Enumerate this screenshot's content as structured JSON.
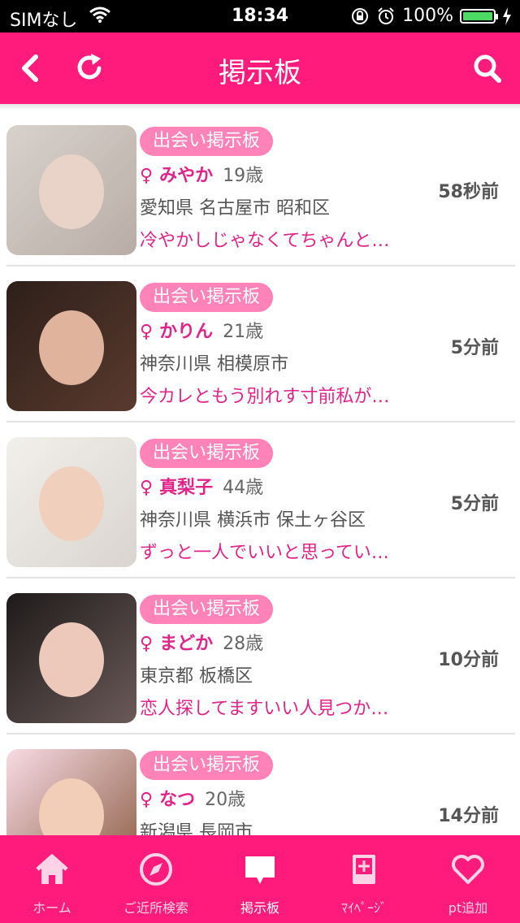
{
  "status_bar": {
    "carrier": "SIMなし",
    "time": "18:34",
    "battery": "100%"
  },
  "header": {
    "title": "掲示板"
  },
  "posts": [
    {
      "badge": "出会い掲示板",
      "sex": "♀",
      "name": "みやか",
      "age": "19歳",
      "location": "愛知県 名古屋市 昭和区",
      "message": "冷やかしじゃなくてちゃんと…",
      "time_ago": "58秒前"
    },
    {
      "badge": "出会い掲示板",
      "sex": "♀",
      "name": "かりん",
      "age": "21歳",
      "location": "神奈川県 相模原市",
      "message": "今カレともう別れす寸前私が…",
      "time_ago": "5分前"
    },
    {
      "badge": "出会い掲示板",
      "sex": "♀",
      "name": "真梨子",
      "age": "44歳",
      "location": "神奈川県 横浜市 保土ヶ谷区",
      "message": "ずっと一人でいいと思ってい…",
      "time_ago": "5分前"
    },
    {
      "badge": "出会い掲示板",
      "sex": "♀",
      "name": "まどか",
      "age": "28歳",
      "location": "東京都 板橋区",
      "message": "恋人探してますいい人見つか…",
      "time_ago": "10分前"
    },
    {
      "badge": "出会い掲示板",
      "sex": "♀",
      "name": "なつ",
      "age": "20歳",
      "location": "新潟県 長岡市",
      "message": "",
      "time_ago": "14分前"
    }
  ],
  "tabs": [
    {
      "label": "ホーム",
      "icon": "home-icon"
    },
    {
      "label": "ご近所検索",
      "icon": "compass-icon"
    },
    {
      "label": "掲示板",
      "icon": "chat-bubble-icon"
    },
    {
      "label": "ﾏｲﾍﾟｰｼﾞ",
      "icon": "book-icon"
    },
    {
      "label": "pt追加",
      "icon": "heart-icon"
    }
  ],
  "colors": {
    "brand": "#ff1b7b",
    "badge": "#ff82b8",
    "accent_text": "#e0248a"
  }
}
